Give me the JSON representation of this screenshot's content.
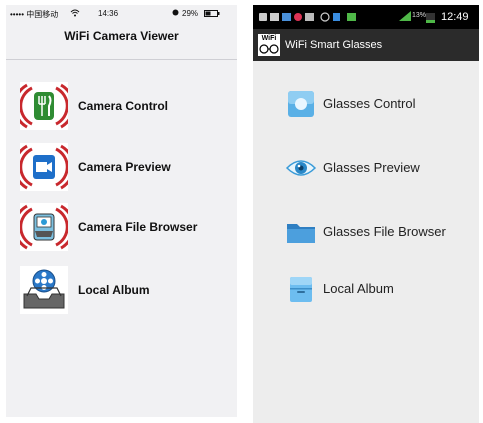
{
  "ios": {
    "status": {
      "carrier": "••••• 中国移动",
      "time": "14:36",
      "battery": "29%"
    },
    "title": "WiFi Camera Viewer",
    "items": [
      {
        "label": "Camera Control",
        "icon": "fork-knife-icon"
      },
      {
        "label": "Camera Preview",
        "icon": "video-camera-icon"
      },
      {
        "label": "Camera File Browser",
        "icon": "file-browser-icon"
      },
      {
        "label": "Local Album",
        "icon": "film-reel-icon"
      }
    ]
  },
  "android": {
    "status": {
      "battery_percent": "13%",
      "time": "12:49"
    },
    "app_icon_text": "WiFi",
    "title": "WiFi Smart Glasses",
    "items": [
      {
        "label": "Glasses Control",
        "icon": "control-square-icon"
      },
      {
        "label": "Glasses Preview",
        "icon": "eye-icon"
      },
      {
        "label": "Glasses File Browser",
        "icon": "folder-icon"
      },
      {
        "label": "Local Album",
        "icon": "album-box-icon"
      }
    ]
  },
  "colors": {
    "ios_bg": "#f1f1f3",
    "android_bg": "#ededed",
    "android_status": "#000000",
    "android_action": "#2b2b2b",
    "ring_red": "#c8282d",
    "icon_blue": "#2a9ad6"
  }
}
